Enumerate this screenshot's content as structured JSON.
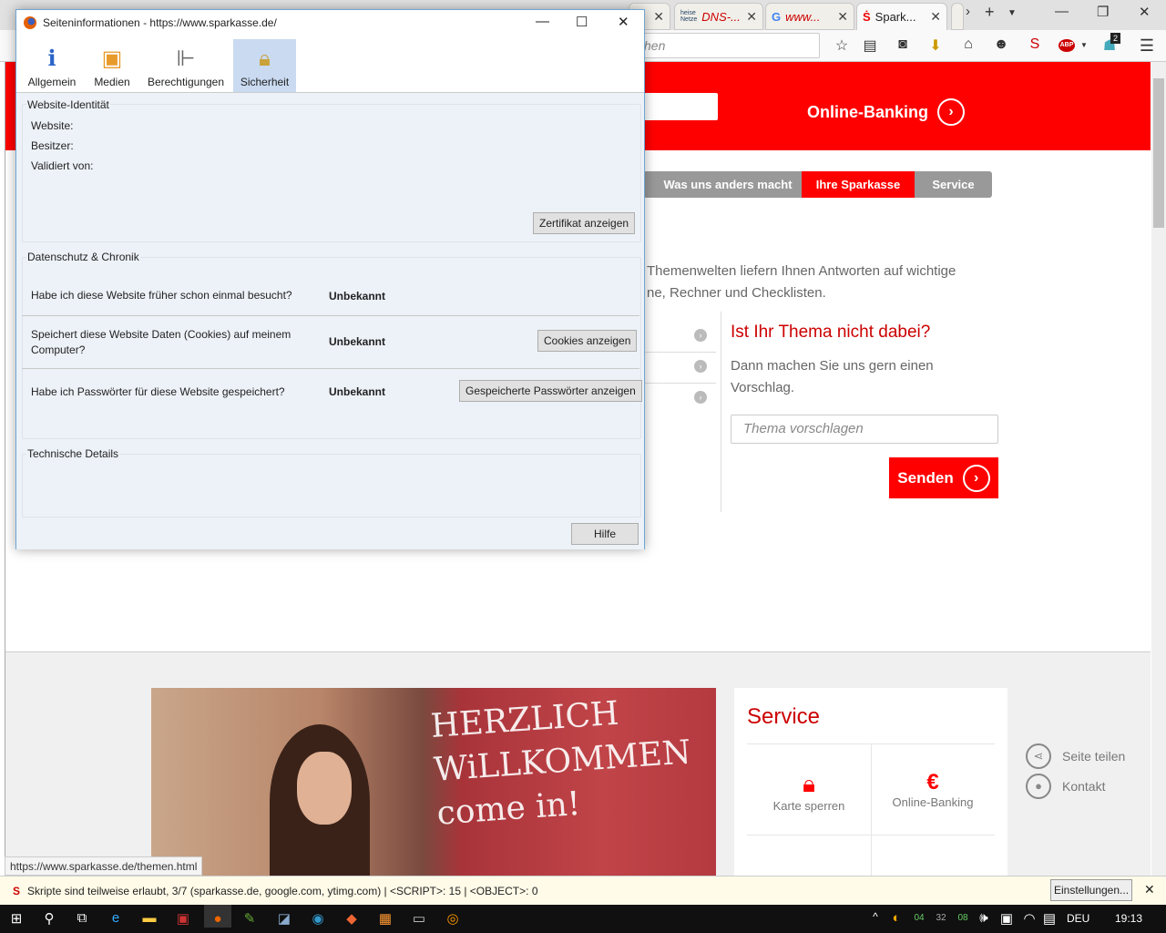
{
  "browser": {
    "tabs": [
      {
        "label": "DNS-...",
        "icon": "heise-netze-icon"
      },
      {
        "label": "www...",
        "icon": "google-icon"
      },
      {
        "label": "Spark...",
        "icon": "sparkasse-icon",
        "active": true
      }
    ],
    "search_placeholder": "hen",
    "badge_count": "2",
    "abp_label": "ABP"
  },
  "page": {
    "header_button": "Online-Banking",
    "nav": [
      "Was uns anders macht",
      "Ihre Sparkasse",
      "Service"
    ],
    "intro": [
      "Themenwelten liefern Ihnen Antworten auf wichtige",
      "ne, Rechner und Checklisten."
    ],
    "question_title": "Ist Ihr Thema nicht dabei?",
    "question_text": "Dann machen Sie uns gern einen Vorschlag.",
    "input_placeholder": "Thema vorschlagen",
    "send_label": "Senden",
    "chalk_lines": [
      "HERZLICH",
      "WiLLKOMMEN",
      "come in!"
    ],
    "service": {
      "title": "Service",
      "items": [
        "Karte sperren",
        "Online-Banking"
      ]
    },
    "side_links": [
      "Seite teilen",
      "Kontakt"
    ],
    "accent": "#ff0000"
  },
  "status_url": "https://www.sparkasse.de/themen.html",
  "noscript": {
    "message": "Skripte sind teilweise erlaubt, 3/7 (sparkasse.de, google.com, ytimg.com) | <SCRIPT>: 15 | <OBJECT>: 0",
    "button": "Einstellungen..."
  },
  "taskbar": {
    "lang": "DEU",
    "time": "19:13",
    "tray_nums": [
      "04",
      "32",
      "08"
    ]
  },
  "dialog": {
    "title": "Seiteninformationen - https://www.sparkasse.de/",
    "tabs": [
      "Allgemein",
      "Medien",
      "Berechtigungen",
      "Sicherheit"
    ],
    "identity": {
      "legend": "Website-Identität",
      "website": "Website:",
      "owner": "Besitzer:",
      "validated": "Validiert von:",
      "cert_button": "Zertifikat anzeigen"
    },
    "privacy": {
      "legend": "Datenschutz & Chronik",
      "rows": [
        {
          "q": "Habe ich diese Website früher schon einmal besucht?",
          "a": "Unbekannt"
        },
        {
          "q": "Speichert diese Website Daten (Cookies) auf meinem Computer?",
          "a": "Unbekannt",
          "button": "Cookies anzeigen"
        },
        {
          "q": "Habe ich Passwörter für diese Website gespeichert?",
          "a": "Unbekannt",
          "button": "Gespeicherte Passwörter anzeigen"
        }
      ]
    },
    "tech": {
      "legend": "Technische Details"
    },
    "help_button": "Hilfe"
  }
}
